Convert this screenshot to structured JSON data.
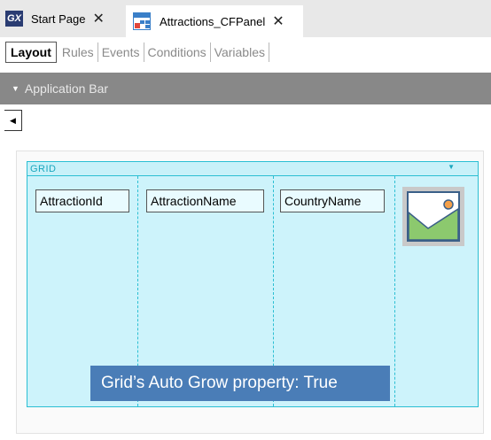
{
  "doc_tabs": [
    {
      "label": "Start Page",
      "icon": "genexus-logo-icon",
      "logo_text": "GX",
      "active": false
    },
    {
      "label": "Attractions_CFPanel",
      "icon": "panel-object-icon",
      "active": true
    }
  ],
  "close_glyph": "✕",
  "sub_tabs": [
    {
      "label": "Layout",
      "selected": true
    },
    {
      "label": "Rules",
      "selected": false
    },
    {
      "label": "Events",
      "selected": false
    },
    {
      "label": "Conditions",
      "selected": false
    },
    {
      "label": "Variables",
      "selected": false
    }
  ],
  "app_bar": {
    "label": "Application Bar",
    "caret_icon": "caret-down-icon"
  },
  "collapse_button": {
    "icon": "caret-left-icon"
  },
  "grid": {
    "label": "GRID",
    "columns": [
      {
        "label": "AttractionId"
      },
      {
        "label": "AttractionName"
      },
      {
        "label": "CountryName"
      }
    ],
    "image_column": {
      "icon": "image-placeholder-icon"
    }
  },
  "callout": {
    "text": "Grid’s Auto Grow property: True"
  },
  "colors": {
    "grid_bg": "#cdf3fb",
    "grid_border": "#2bbfd3",
    "app_bar_bg": "#888888",
    "callout_bg": "#4a7db7",
    "tab_strip_bg": "#e8e8e8"
  }
}
